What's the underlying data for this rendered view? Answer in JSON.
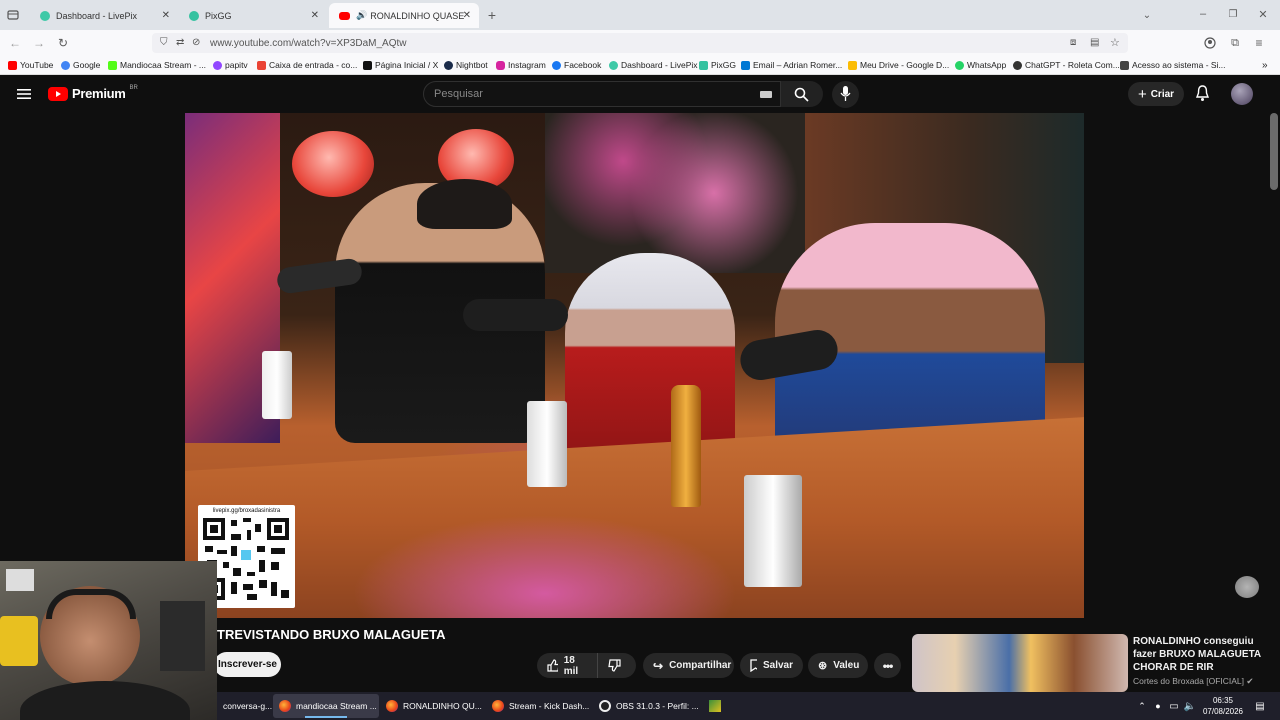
{
  "tabs": [
    {
      "title": "Dashboard - LivePix",
      "color": "#3ec9a7",
      "active": false
    },
    {
      "title": "PixGG",
      "color": "#35c2a0",
      "active": false
    },
    {
      "title": "RONALDINHO QUASE APA",
      "color": "#ff0000",
      "active": true
    }
  ],
  "nav": {
    "url": "www.youtube.com/watch?v=XP3DaM_AQtw"
  },
  "bookmarks": [
    {
      "label": "YouTube",
      "color": "#ff0000"
    },
    {
      "label": "Google",
      "color": "#4285f4"
    },
    {
      "label": "Mandiocaa Stream - ...",
      "color": "#53fc18"
    },
    {
      "label": "papitv",
      "color": "#9147ff"
    },
    {
      "label": "Caixa de entrada - co...",
      "color": "#ea4335"
    },
    {
      "label": "Página Inicial / X",
      "color": "#111111"
    },
    {
      "label": "Nightbot",
      "color": "#1a2b4a"
    },
    {
      "label": "Instagram",
      "color": "#d6249f"
    },
    {
      "label": "Facebook",
      "color": "#1877f2"
    },
    {
      "label": "Dashboard - LivePix",
      "color": "#3ec9a7"
    },
    {
      "label": "PixGG",
      "color": "#35c2a0"
    },
    {
      "label": "Email – Adrian Romer...",
      "color": "#0078d4"
    },
    {
      "label": "Meu Drive - Google D...",
      "color": "#fbbc04"
    },
    {
      "label": "WhatsApp",
      "color": "#25d366"
    },
    {
      "label": "ChatGPT - Roleta Com...",
      "color": "#333333"
    },
    {
      "label": "Acesso ao sistema - Si...",
      "color": "#444444"
    }
  ],
  "youtube": {
    "logo": "Premium",
    "region": "BR",
    "search_placeholder": "Pesquisar",
    "create_label": "Criar"
  },
  "video": {
    "qr_caption": "livepix.gg/broxadasinistra",
    "title": "TREVISTANDO BRUXO MALAGUETA",
    "subscribe": "Inscrever-se",
    "likes": "18 mil",
    "share": "Compartilhar",
    "save": "Salvar",
    "thanks": "Valeu"
  },
  "recommended": {
    "title": "RONALDINHO conseguiu fazer BRUXO MALAGUETA CHORAR DE RIR",
    "channel": "Cortes do Broxada [OFICIAL]"
  },
  "taskbar": {
    "items": [
      "conversa-g...",
      "mandiocaa Stream ...",
      "RONALDINHO QU...",
      "Stream - Kick Dash...",
      "OBS 31.0.3 - Perfil: ..."
    ],
    "time": "06:35",
    "date": "07/08/2026"
  },
  "colors": {
    "youtube_red": "#ff0000",
    "yt_bg": "#0f0f0f",
    "accent_blue": "#76b9ed"
  }
}
